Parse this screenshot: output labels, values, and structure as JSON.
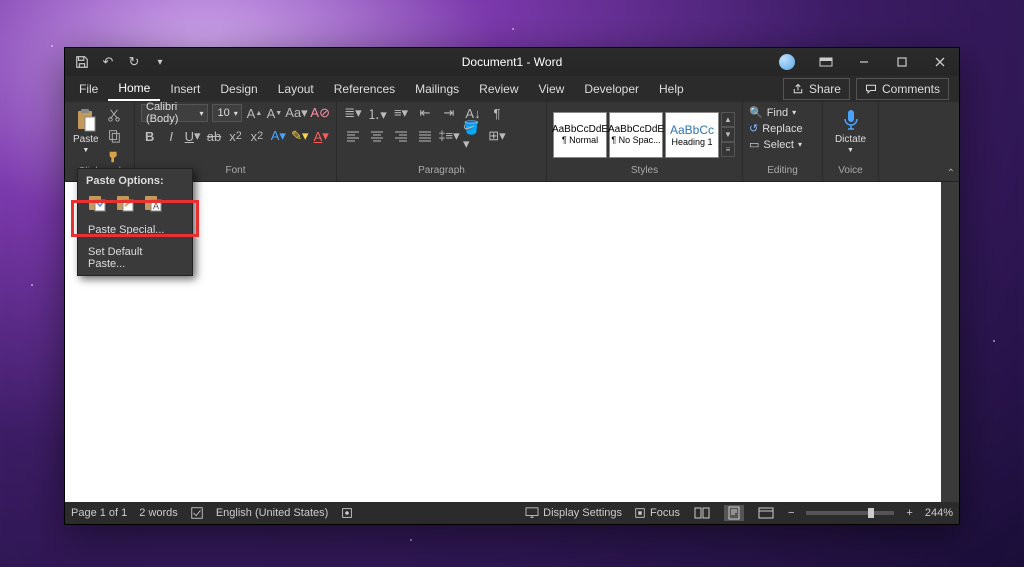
{
  "title": "Document1 - Word",
  "qat": {
    "save": "💾",
    "undo": "↶",
    "redo": "↻"
  },
  "tabs": [
    "File",
    "Home",
    "Insert",
    "Design",
    "Layout",
    "References",
    "Mailings",
    "Review",
    "View",
    "Developer",
    "Help"
  ],
  "active_tab": "Home",
  "share": "Share",
  "comments": "Comments",
  "ribbon": {
    "clipboard": {
      "paste": "Paste",
      "label": "Clipboard"
    },
    "font": {
      "name": "Calibri (Body)",
      "size": "10",
      "label": "Font"
    },
    "paragraph": {
      "label": "Paragraph"
    },
    "styles": {
      "items": [
        {
          "preview": "AaBbCcDdE",
          "name": "¶ Normal"
        },
        {
          "preview": "AaBbCcDdE",
          "name": "¶ No Spac..."
        },
        {
          "preview": "AaBbCc",
          "name": "Heading 1"
        }
      ],
      "label": "Styles"
    },
    "editing": {
      "find": "Find",
      "replace": "Replace",
      "select": "Select",
      "label": "Editing"
    },
    "voice": {
      "dictate": "Dictate",
      "label": "Voice"
    }
  },
  "paste_menu": {
    "header": "Paste Options:",
    "special": "Paste Special...",
    "default": "Set Default Paste..."
  },
  "status": {
    "page": "Page 1 of 1",
    "words": "2 words",
    "lang": "English (United States)",
    "display": "Display Settings",
    "focus": "Focus",
    "zoom": "244%"
  }
}
